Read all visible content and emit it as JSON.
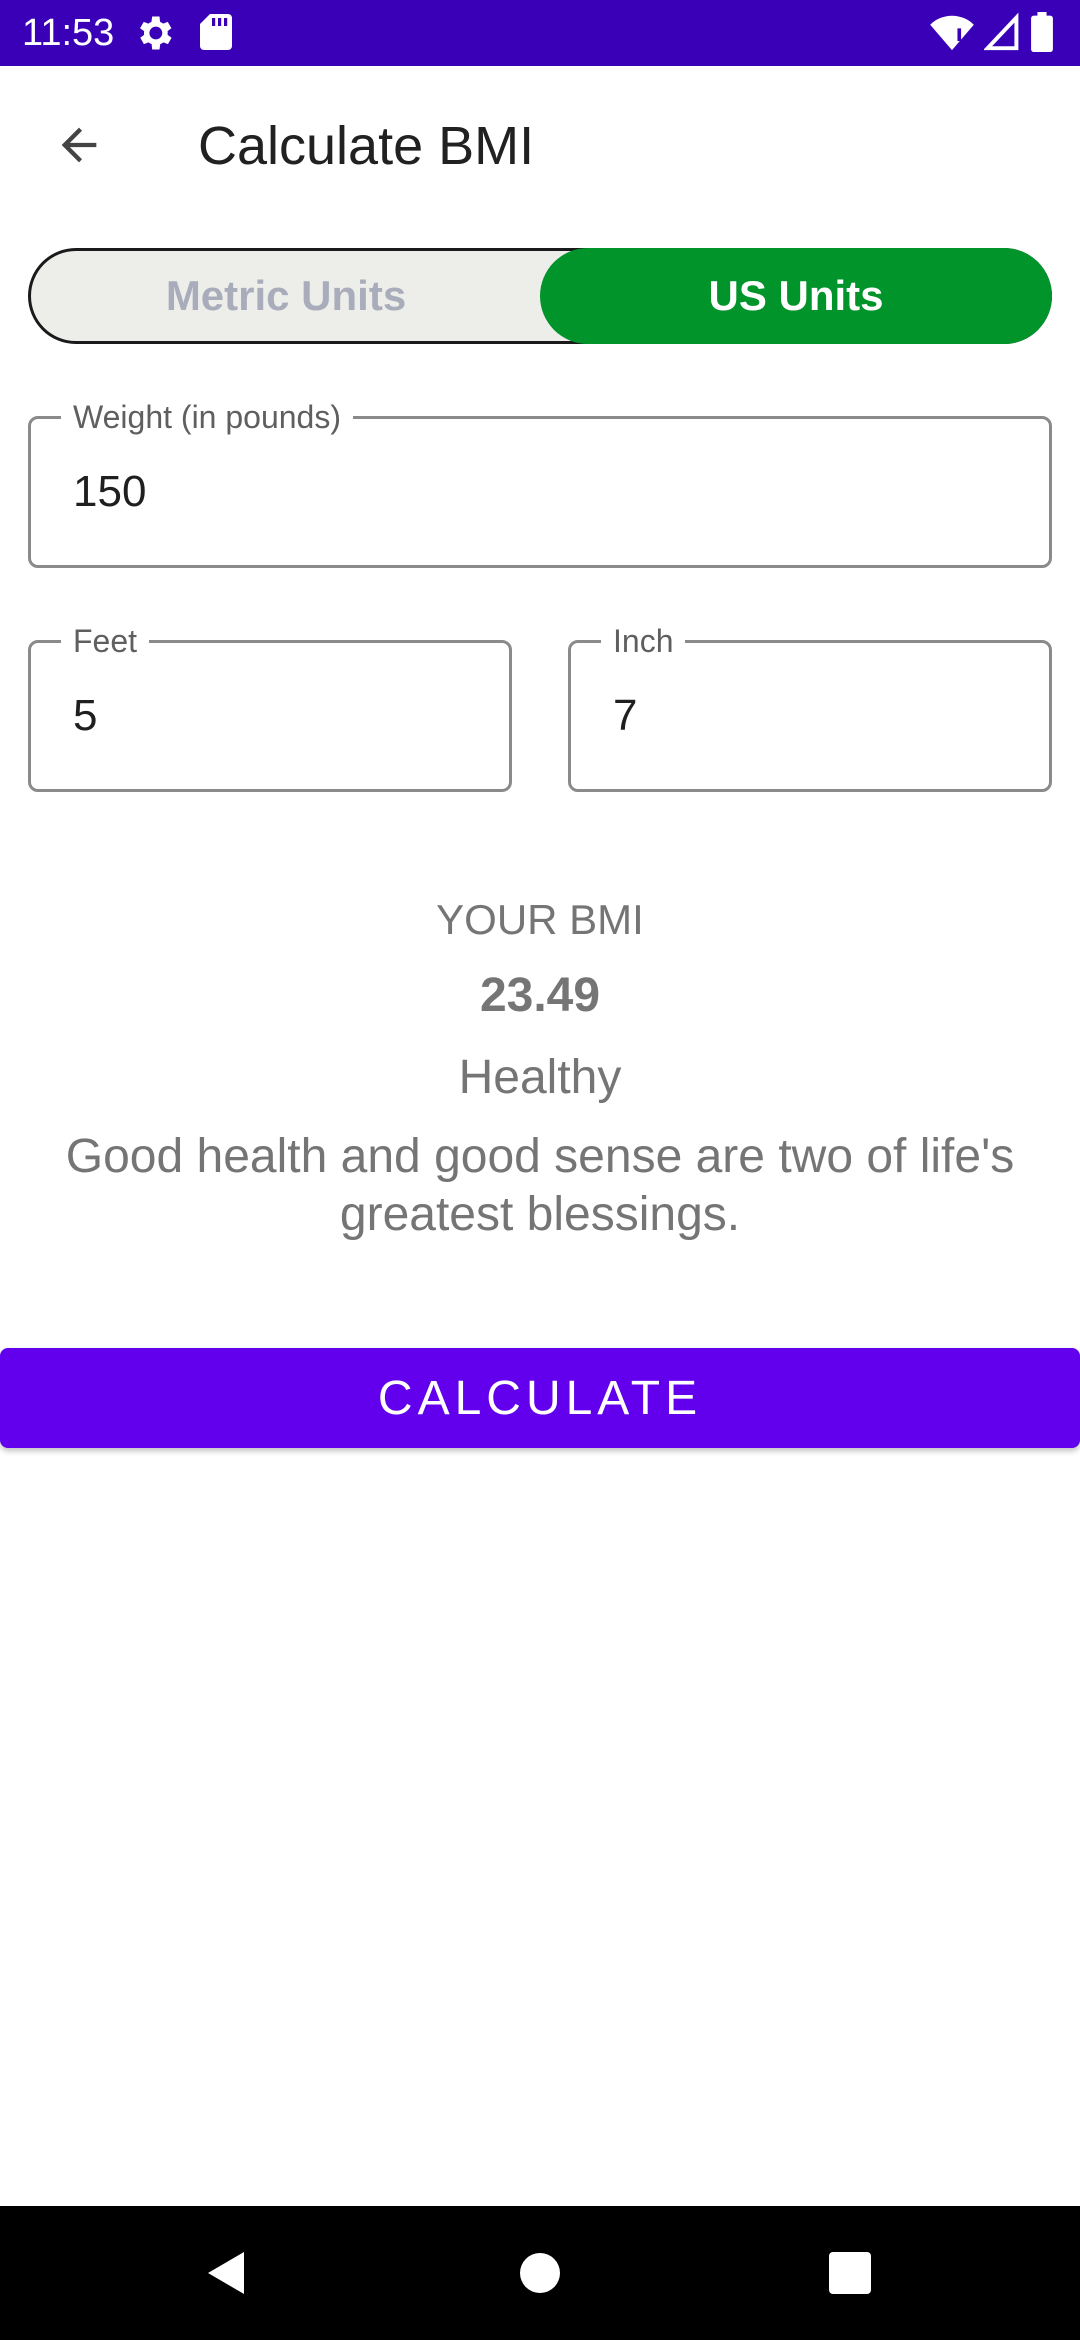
{
  "status_bar": {
    "time": "11:53",
    "icons": [
      "gear-icon",
      "sd-card-icon",
      "wifi-icon",
      "signal-icon",
      "battery-icon"
    ]
  },
  "app_bar": {
    "title": "Calculate BMI",
    "back_icon": "arrow-back-icon"
  },
  "unit_toggle": {
    "metric_label": "Metric Units",
    "us_label": "US Units",
    "selected": "US Units",
    "selected_color": "#00942a"
  },
  "fields": {
    "weight": {
      "label": "Weight (in pounds)",
      "value": "150"
    },
    "feet": {
      "label": "Feet",
      "value": "5"
    },
    "inch": {
      "label": "Inch",
      "value": "7"
    }
  },
  "result": {
    "label": "YOUR BMI",
    "value": "23.49",
    "status": "Healthy",
    "quote": "Good health and good sense are two of life's greatest blessings."
  },
  "calculate_button": {
    "label": "CALCULATE",
    "color": "#6200ee"
  },
  "nav_bar": {
    "icons": [
      "nav-back-icon",
      "nav-home-icon",
      "nav-recents-icon"
    ]
  },
  "colors": {
    "status_bar": "#3a00b8",
    "accent": "#6200ee",
    "toggle_active": "#00942a"
  }
}
